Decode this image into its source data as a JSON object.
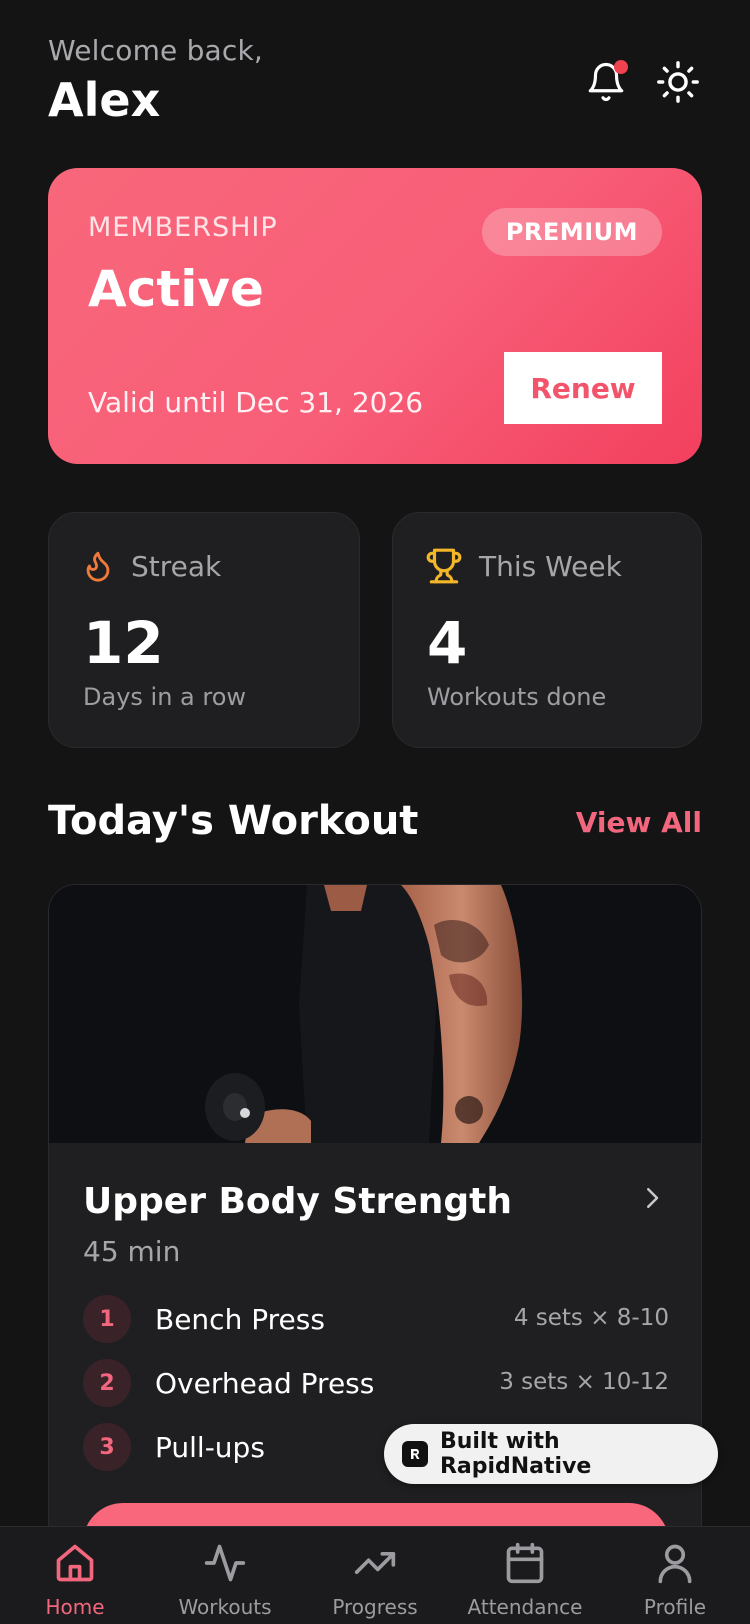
{
  "header": {
    "welcome": "Welcome back,",
    "username": "Alex",
    "notification_icon": "bell-icon",
    "theme_icon": "sun-icon",
    "notification_dot_color": "#f0424f"
  },
  "membership": {
    "label": "MEMBERSHIP",
    "status": "Active",
    "badge": "PREMIUM",
    "valid_until": "Valid until Dec 31, 2026",
    "renew_label": "Renew",
    "gradient_colors": [
      "#f8677b",
      "#f2405e"
    ]
  },
  "stats": [
    {
      "icon": "flame-icon",
      "title": "Streak",
      "value": "12",
      "subtitle": "Days in a row",
      "icon_color": "#f07a3a"
    },
    {
      "icon": "trophy-icon",
      "title": "This Week",
      "value": "4",
      "subtitle": "Workouts done",
      "icon_color": "#f2b628"
    }
  ],
  "section": {
    "title": "Today's Workout",
    "view_all": "View All"
  },
  "workout": {
    "title": "Upper Body Strength",
    "duration": "45 min",
    "exercises": [
      {
        "num": "1",
        "name": "Bench Press",
        "sets": "4 sets × 8-10"
      },
      {
        "num": "2",
        "name": "Overhead Press",
        "sets": "3 sets × 10-12"
      },
      {
        "num": "3",
        "name": "Pull-ups",
        "sets": ""
      }
    ]
  },
  "badge": {
    "text": "Built with RapidNative"
  },
  "nav": {
    "items": [
      {
        "label": "Home",
        "icon": "home-icon",
        "active": true
      },
      {
        "label": "Workouts",
        "icon": "activity-icon",
        "active": false
      },
      {
        "label": "Progress",
        "icon": "trending-up-icon",
        "active": false
      },
      {
        "label": "Attendance",
        "icon": "calendar-icon",
        "active": false
      },
      {
        "label": "Profile",
        "icon": "user-icon",
        "active": false
      }
    ]
  },
  "colors": {
    "accent": "#f2677d",
    "background": "#141415",
    "card": "#1f1f21"
  }
}
